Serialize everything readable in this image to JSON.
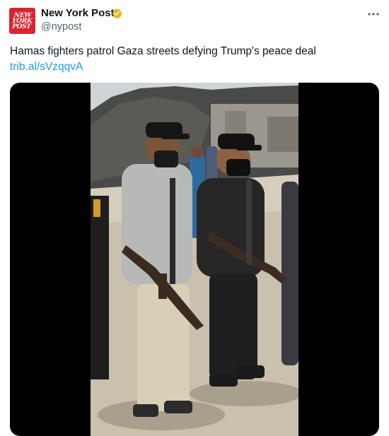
{
  "author": {
    "name": "New York Post",
    "handle": "@nypost",
    "avatar_logo_lines": [
      "NEW",
      "YORK",
      "POST"
    ],
    "avatar_color": "#d8262e",
    "verified_badge_color": "#e8b624"
  },
  "tweet": {
    "text": "Hamas fighters patrol Gaza streets defying Trump's peace deal",
    "link": "trib.al/sVzqqvA",
    "link_color": "#1d9bf0"
  },
  "icons": {
    "more": "more-horizontal-icon",
    "verified": "verified-badge-icon"
  },
  "colors": {
    "text_primary": "#0f1419",
    "text_secondary": "#536471",
    "media_background": "#000000"
  }
}
